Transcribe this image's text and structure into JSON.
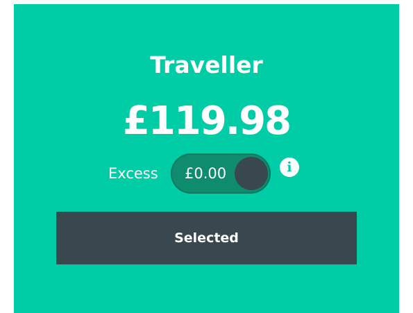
{
  "plan": {
    "title": "Traveller",
    "price": "£119.98"
  },
  "excess": {
    "label": "Excess",
    "value": "£0.00",
    "info_icon": "info-icon"
  },
  "action": {
    "label": "Selected"
  },
  "colors": {
    "card_background": "#00cda6",
    "toggle_background": "#0f8c6e",
    "knob": "#39474f",
    "button_background": "#39474f",
    "text": "#ffffff"
  }
}
